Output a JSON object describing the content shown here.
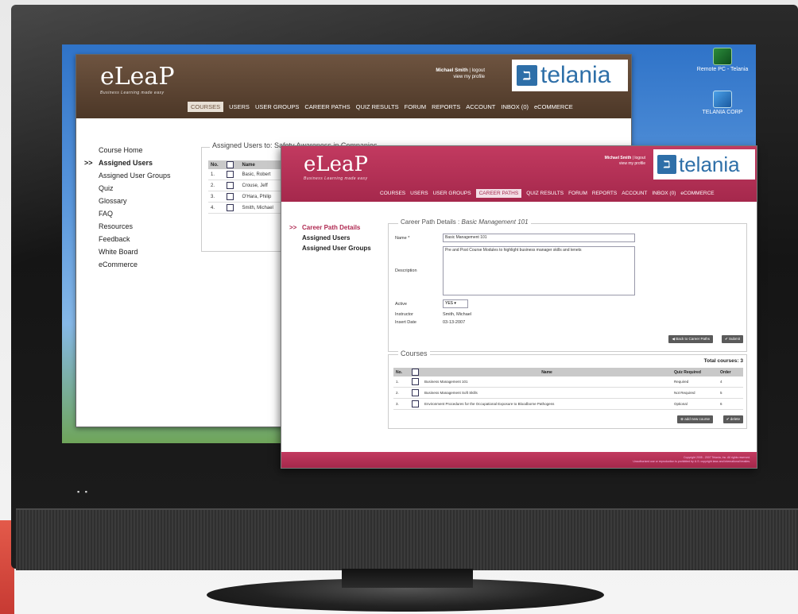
{
  "colors": {
    "brown_header": "#6e5440",
    "pink_header": "#c23a60",
    "telania_blue": "#2e6fa8"
  },
  "back_window": {
    "logo": "eLeaP",
    "logo_sub": "Business Learning made easy",
    "user": {
      "name": "Michael Smith",
      "logout": "logout",
      "profile": "view my profile"
    },
    "brand": "telania",
    "nav": [
      "COURSES",
      "USERS",
      "USER GROUPS",
      "CAREER PATHS",
      "QUIZ RESULTS",
      "FORUM",
      "REPORTS",
      "ACCOUNT",
      "INBOX",
      "eCOMMERCE"
    ],
    "inbox_count": "0",
    "sidebar": {
      "arrow": ">>",
      "items": [
        "Course Home",
        "Assigned Users",
        "Assigned User Groups",
        "Quiz",
        "Glossary",
        "FAQ",
        "Resources",
        "Feedback",
        "White Board",
        "eCommerce"
      ],
      "current": 1
    },
    "fieldset_title": "Assigned Users to: Safety Awareness in Companies",
    "table": {
      "headers": [
        "No.",
        "Name"
      ],
      "rows": [
        [
          "1.",
          "Basic, Robert"
        ],
        [
          "2.",
          "Crouse, Jeff"
        ],
        [
          "3.",
          "O'Hara, Philip"
        ],
        [
          "4.",
          "Smith, Michael"
        ]
      ]
    }
  },
  "front_window": {
    "logo": "eLeaP",
    "logo_sub": "Business Learning made easy",
    "user": {
      "name": "Michael Smith",
      "logout": "logout",
      "profile": "view my profile"
    },
    "brand": "telania",
    "nav": [
      "COURSES",
      "USERS",
      "USER GROUPS",
      "CAREER PATHS",
      "QUIZ RESULTS",
      "FORUM",
      "REPORTS",
      "ACCOUNT",
      "INBOX",
      "eCOMMERCE"
    ],
    "inbox_count": "0",
    "sidebar": {
      "arrow": ">>",
      "items": [
        "Career Path Details",
        "Assigned Users",
        "Assigned User Groups"
      ],
      "current": 0
    },
    "details": {
      "legend_prefix": "Career Path Details : ",
      "legend_name": "Basic Management 101",
      "name_label": "Name *",
      "name_value": "Basic Management 101",
      "description_label": "Description",
      "description_value": "Pre and Post Course Modules to highlight business manager skills and tenets",
      "active_label": "Active",
      "active_value": "YES",
      "instructor_label": "Instructor",
      "instructor_value": "Smith, Michael",
      "insert_date_label": "Insert Date",
      "insert_date_value": "03-13-2007",
      "back_button": "Back to Career Paths",
      "submit_button": "Submit"
    },
    "courses": {
      "legend": "Courses",
      "total": "Total courses: 3",
      "headers": [
        "No.",
        "Name",
        "Quiz Required",
        "Order"
      ],
      "rows": [
        [
          "1.",
          "Business Management 101",
          "Required",
          "4"
        ],
        [
          "2.",
          "Business Management Soft Skills",
          "Not Required",
          "5"
        ],
        [
          "3.",
          "Environment Procedures for the Occupational Exposure to Bloodborne Pathogens",
          "Optional",
          "6"
        ]
      ],
      "add_button": "add new course",
      "delete_button": "delete"
    },
    "footer": [
      "Copyright 2005 - 2007 Telania, Inc. All rights reserved.",
      "Unauthorized use or reproduction is prohibited by U.S. copyright laws and international treaties."
    ]
  },
  "desktop_icons": [
    {
      "label": "Remote PC - Telania"
    },
    {
      "label": "TELANIA CORP"
    }
  ],
  "monitor_power": "▪ ▪"
}
